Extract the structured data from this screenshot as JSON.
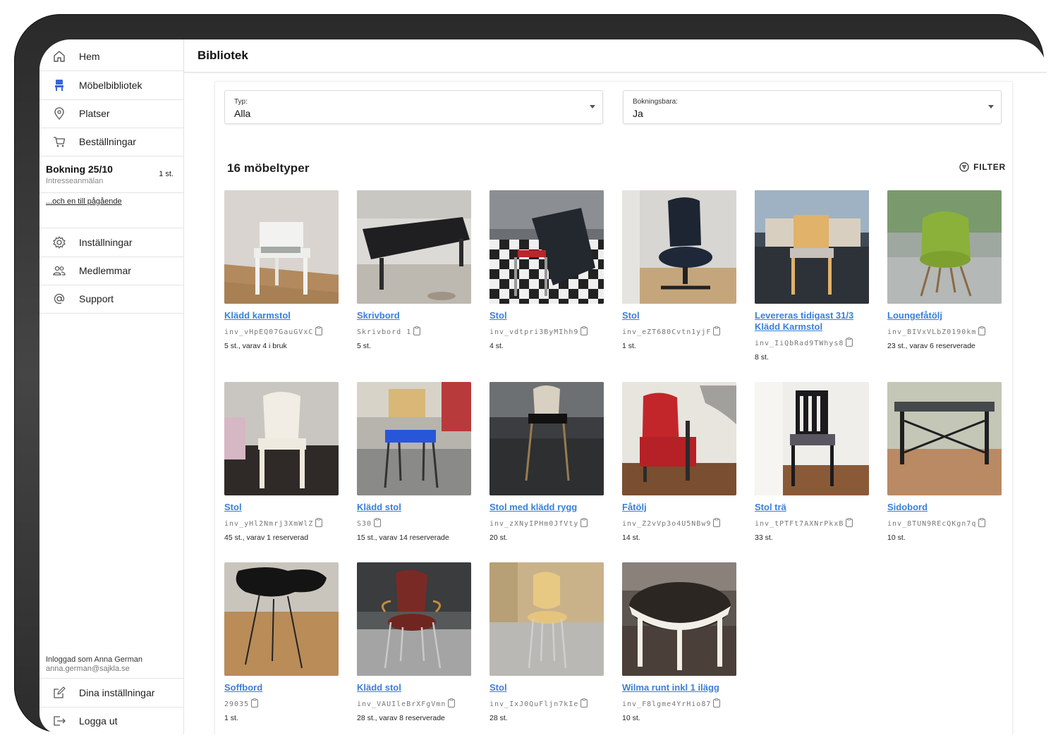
{
  "sidebar": {
    "nav_top": [
      {
        "label": "Hem",
        "icon": "home-icon"
      },
      {
        "label": "Möbelbibliotek",
        "icon": "chair-icon"
      },
      {
        "label": "Platser",
        "icon": "location-pin-icon"
      },
      {
        "label": "Beställningar",
        "icon": "cart-icon"
      }
    ],
    "booking": {
      "title": "Bokning 25/10",
      "subtitle": "Intresseanmälan",
      "count": "1 st."
    },
    "more_link": "...och en till pågående",
    "nav_mid": [
      {
        "label": "Inställningar",
        "icon": "gear-icon"
      },
      {
        "label": "Medlemmar",
        "icon": "users-icon"
      },
      {
        "label": "Support",
        "icon": "at-sign-icon"
      }
    ],
    "logged_in": {
      "line": "Inloggad som Anna German",
      "email": "anna.german@sajkla.se"
    },
    "nav_bottom": [
      {
        "label": "Dina inställningar",
        "icon": "edit-icon"
      },
      {
        "label": "Logga ut",
        "icon": "logout-icon"
      }
    ]
  },
  "header": {
    "title": "Bibliotek"
  },
  "filters": {
    "type": {
      "label": "Typ:",
      "value": "Alla"
    },
    "bookable": {
      "label": "Bokningsbara:",
      "value": "Ja"
    }
  },
  "results": {
    "title": "16 möbeltyper",
    "filter_label": "FILTER"
  },
  "accent": "#3a7fd9",
  "items": [
    {
      "name": "Klädd karmstol",
      "code": "inv_vHpEQ07GauGVxC",
      "qty": "5 st., varav 4 i bruk"
    },
    {
      "name": "Skrivbord",
      "code": "Skrivbord 1",
      "qty": "5 st."
    },
    {
      "name": "Stol",
      "code": "inv_vdtpri3ByMIhh9",
      "qty": "4 st."
    },
    {
      "name": "Stol",
      "code": "inv_eZT680Cvtn1yjF",
      "qty": "1 st."
    },
    {
      "name": "Levereras tidigast 31/3 Klädd Karmstol",
      "code": "inv_IiQbRad9TWhys8",
      "qty": "8 st."
    },
    {
      "name": "Loungefåtölj",
      "code": "inv_BIVxVLbZ0190km",
      "qty": "23 st., varav 6 reserverade"
    },
    {
      "name": "Stol",
      "code": "inv_yHl2Nmrj3XmWlZ",
      "qty": "45 st., varav 1 reserverad"
    },
    {
      "name": "Klädd stol",
      "code": "S30",
      "qty": "15 st., varav 14 reserverade"
    },
    {
      "name": "Stol med klädd rygg",
      "code": "inv_zXNyIPHm0JfVty",
      "qty": "20 st."
    },
    {
      "name": "Fåtölj",
      "code": "inv_Z2vVp3o4U5NBw9",
      "qty": "14 st."
    },
    {
      "name": "Stol trä",
      "code": "inv_tPTFt7AXNrPkxB",
      "qty": "33 st."
    },
    {
      "name": "Sidobord",
      "code": "inv_8TUN9REcQKgn7q",
      "qty": "10 st."
    },
    {
      "name": "Soffbord",
      "code": "29035",
      "qty": "1 st."
    },
    {
      "name": "Klädd stol",
      "code": "inv_VAUIleBrXFgVmn",
      "qty": "28 st., varav 8 reserverade"
    },
    {
      "name": "Stol",
      "code": "inv_IxJ0QuFljn7kIe",
      "qty": "28 st."
    },
    {
      "name": "Wilma runt inkl 1 ilägg",
      "code": "inv_F8lgme4YrHio87",
      "qty": "10 st."
    }
  ]
}
